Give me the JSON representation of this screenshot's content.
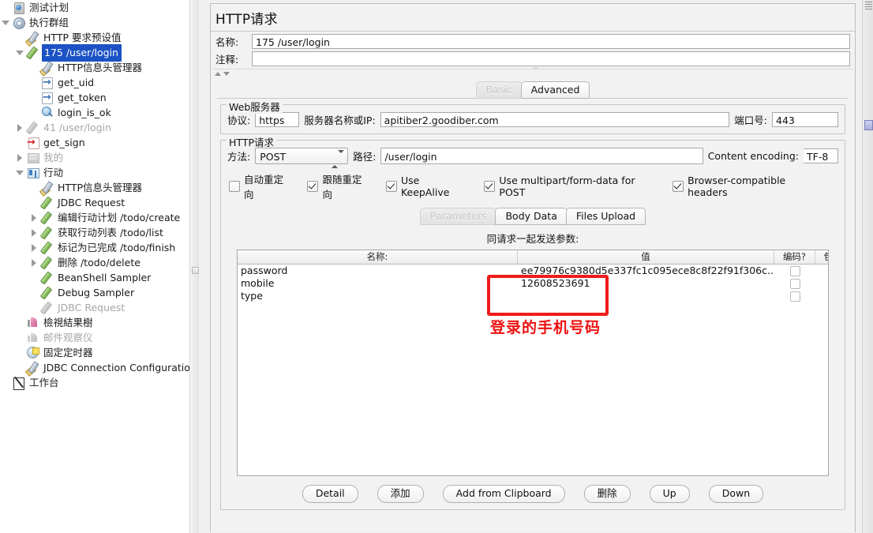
{
  "tree": {
    "items": [
      {
        "label": "测试计划",
        "depth": 0,
        "toggle": "none",
        "icon": "testplan-icon",
        "state": "normal"
      },
      {
        "label": "执行群组",
        "depth": 0,
        "toggle": "expanded",
        "icon": "thread-group-icon",
        "state": "normal"
      },
      {
        "label": "HTTP 要求预设值",
        "depth": 1,
        "toggle": "none",
        "icon": "http-defaults-icon",
        "state": "normal"
      },
      {
        "label": "175 /user/login",
        "depth": 1,
        "toggle": "expanded",
        "icon": "http-sampler-icon",
        "state": "selected"
      },
      {
        "label": "HTTP信息头管理器",
        "depth": 2,
        "toggle": "none",
        "icon": "header-manager-icon",
        "state": "normal"
      },
      {
        "label": "get_uid",
        "depth": 2,
        "toggle": "none",
        "icon": "extractor-icon",
        "state": "normal"
      },
      {
        "label": "get_token",
        "depth": 2,
        "toggle": "none",
        "icon": "extractor-icon",
        "state": "normal"
      },
      {
        "label": "login_is_ok",
        "depth": 2,
        "toggle": "none",
        "icon": "assertion-icon",
        "state": "normal"
      },
      {
        "label": "41 /user/login",
        "depth": 1,
        "toggle": "collapsed",
        "icon": "http-sampler-disabled-icon",
        "state": "disabled"
      },
      {
        "label": "get_sign",
        "depth": 1,
        "toggle": "none",
        "icon": "preprocessor-icon",
        "state": "normal"
      },
      {
        "label": "我的",
        "depth": 1,
        "toggle": "collapsed",
        "icon": "controller-disabled-icon",
        "state": "disabled"
      },
      {
        "label": "行动",
        "depth": 1,
        "toggle": "expanded",
        "icon": "controller-icon",
        "state": "normal"
      },
      {
        "label": "HTTP信息头管理器",
        "depth": 2,
        "toggle": "none",
        "icon": "header-manager-icon",
        "state": "normal"
      },
      {
        "label": "JDBC Request",
        "depth": 2,
        "toggle": "none",
        "icon": "jdbc-request-icon",
        "state": "normal"
      },
      {
        "label": "编辑行动计划 /todo/create",
        "depth": 2,
        "toggle": "collapsed",
        "icon": "http-sampler-icon",
        "state": "normal"
      },
      {
        "label": "获取行动列表 /todo/list",
        "depth": 2,
        "toggle": "collapsed",
        "icon": "http-sampler-icon",
        "state": "normal"
      },
      {
        "label": "标记为已完成 /todo/finish",
        "depth": 2,
        "toggle": "collapsed",
        "icon": "http-sampler-icon",
        "state": "normal"
      },
      {
        "label": "删除 /todo/delete",
        "depth": 2,
        "toggle": "collapsed",
        "icon": "http-sampler-icon",
        "state": "normal"
      },
      {
        "label": "BeanShell Sampler",
        "depth": 2,
        "toggle": "none",
        "icon": "beanshell-sampler-icon",
        "state": "normal"
      },
      {
        "label": "Debug Sampler",
        "depth": 2,
        "toggle": "none",
        "icon": "debug-sampler-icon",
        "state": "normal"
      },
      {
        "label": "JDBC Request",
        "depth": 2,
        "toggle": "none",
        "icon": "jdbc-request-disabled-icon",
        "state": "disabled"
      },
      {
        "label": "檢視結果樹",
        "depth": 1,
        "toggle": "none",
        "icon": "view-results-tree-icon",
        "state": "normal"
      },
      {
        "label": "邮件观察仪",
        "depth": 1,
        "toggle": "none",
        "icon": "mail-visualizer-disabled-icon",
        "state": "disabled"
      },
      {
        "label": "固定定时器",
        "depth": 1,
        "toggle": "none",
        "icon": "constant-timer-icon",
        "state": "normal"
      },
      {
        "label": "JDBC Connection Configuration",
        "depth": 1,
        "toggle": "none",
        "icon": "jdbc-connection-config-icon",
        "state": "normal"
      },
      {
        "label": "工作台",
        "depth": 0,
        "toggle": "none",
        "icon": "workbench-icon",
        "state": "normal"
      }
    ]
  },
  "panel": {
    "title": "HTTP请求",
    "name_label": "名称:",
    "name_value": "175 /user/login",
    "comment_label": "注释:",
    "comment_value": "",
    "tabs": [
      {
        "label": "Basic",
        "selected": false
      },
      {
        "label": "Advanced",
        "selected": true
      }
    ],
    "web_server": {
      "group_title": "Web服务器",
      "protocol_label": "协议:",
      "protocol_value": "https",
      "server_label": "服务器名称或IP:",
      "server_value": "apitiber2.goodiber.com",
      "port_label": "端口号:",
      "port_value": "443"
    },
    "http_request": {
      "group_title": "HTTP请求",
      "method_label": "方法:",
      "method_value": "POST",
      "path_label": "路径:",
      "path_value": "/user/login",
      "encoding_label": "Content encoding:",
      "encoding_value": "TF-8",
      "options": [
        {
          "label": "自动重定向",
          "checked": false
        },
        {
          "label": "跟随重定向",
          "checked": true
        },
        {
          "label": "Use KeepAlive",
          "checked": true
        },
        {
          "label": "Use multipart/form-data for POST",
          "checked": true
        },
        {
          "label": "Browser-compatible headers",
          "checked": true
        }
      ],
      "data_tabs": [
        {
          "label": "Parameters",
          "selected": true
        },
        {
          "label": "Body Data",
          "selected": false
        },
        {
          "label": "Files Upload",
          "selected": false
        }
      ],
      "params_caption": "同请求一起发送参数:",
      "table": {
        "columns": [
          "名称:",
          "值",
          "编码?",
          "包含等于?"
        ],
        "rows": [
          {
            "name": "password",
            "value": "ee79976c9380d5e337fc1c095ece8c8f22f91f306c...",
            "encode": false,
            "include_equals": true
          },
          {
            "name": "mobile",
            "value": "12608523691",
            "encode": false,
            "include_equals": true
          },
          {
            "name": "type",
            "value": "",
            "encode": false,
            "include_equals": true
          }
        ]
      },
      "buttons": [
        "Detail",
        "添加",
        "Add from Clipboard",
        "删除",
        "Up",
        "Down"
      ]
    }
  },
  "annotation": {
    "text": "登录的手机号码",
    "color": "#ee1111",
    "highlight_color": "#ee1b1b"
  }
}
